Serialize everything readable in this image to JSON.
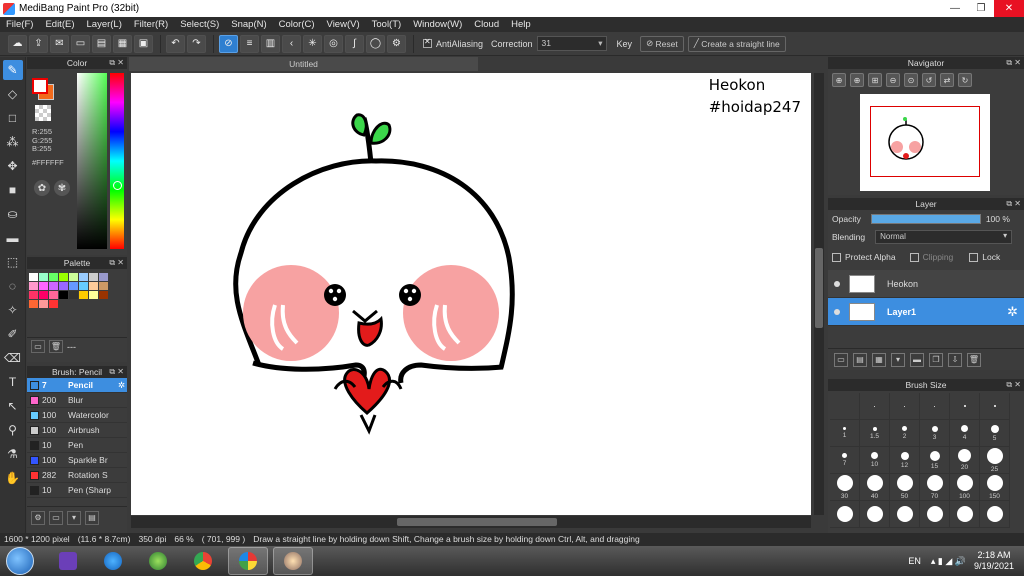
{
  "window": {
    "title": "MediBang Paint Pro (32bit)",
    "controls": [
      "—",
      "❐",
      "✕"
    ]
  },
  "menu": [
    "File(F)",
    "Edit(E)",
    "Layer(L)",
    "Filter(R)",
    "Select(S)",
    "Snap(N)",
    "Color(C)",
    "View(V)",
    "Tool(T)",
    "Window(W)",
    "Cloud",
    "Help"
  ],
  "toolbar": {
    "antialiasing_label": "AntiAliasing",
    "correction_label": "Correction",
    "correction_value": "31",
    "key_label": "Key",
    "reset_label": "Reset",
    "straight_line_label": "Create a straight line"
  },
  "color_panel": {
    "title": "Color",
    "r": "R:255",
    "g": "G:255",
    "b": "B:255",
    "hex": "#FFFFFF",
    "fg_color": "#FFFFFF",
    "bg_color": "#F26A1B"
  },
  "palette_panel": {
    "title": "Palette",
    "footer_text": "---",
    "colors": [
      "#ffffff",
      "#99ffcc",
      "#66ff66",
      "#99ff00",
      "#ccff99",
      "#99ccff",
      "#cccccc",
      "#9999cc",
      "#ff99cc",
      "#ff66ff",
      "#cc66ff",
      "#9966ff",
      "#6699ff",
      "#66ccff",
      "#ffcc99",
      "#cc9966",
      "#ff3366",
      "#ff0066",
      "#ff6699",
      "#000000",
      "#333333",
      "#ffcc00",
      "#ffff99",
      "#993300",
      "#ff6633",
      "#ff9999",
      "#ff3333",
      "#",
      "#",
      "#",
      "#",
      "#"
    ]
  },
  "brush_panel": {
    "title": "Brush: Pencil",
    "items": [
      {
        "size": "7",
        "name": "Pencil",
        "color": "#3d8ee0",
        "active": true
      },
      {
        "size": "200",
        "name": "Blur",
        "color": "#ff66cc",
        "active": false
      },
      {
        "size": "100",
        "name": "Watercolor",
        "color": "#66ccff",
        "active": false
      },
      {
        "size": "100",
        "name": "Airbrush",
        "color": "#cccccc",
        "active": false
      },
      {
        "size": "10",
        "name": "Pen",
        "color": "#222222",
        "active": false
      },
      {
        "size": "100",
        "name": "Sparkle Br",
        "color": "#3355ff",
        "active": false
      },
      {
        "size": "282",
        "name": "Rotation S",
        "color": "#ff3333",
        "active": false
      },
      {
        "size": "10",
        "name": "Pen (Sharp",
        "color": "#222222",
        "active": false
      }
    ]
  },
  "canvas": {
    "tab_title": "Untitled",
    "overlay_line1": "Heokon",
    "overlay_line2": "#hoidap247"
  },
  "navigator": {
    "title": "Navigator"
  },
  "layer_panel": {
    "title": "Layer",
    "opacity_label": "Opacity",
    "opacity_value": "100 %",
    "opacity_fraction": 1.0,
    "blending_label": "Blending",
    "blending_value": "Normal",
    "protect_alpha_label": "Protect Alpha",
    "clipping_label": "Clipping",
    "lock_label": "Lock",
    "layers": [
      {
        "name": "Heokon",
        "active": false
      },
      {
        "name": "Layer1",
        "active": true
      }
    ]
  },
  "brush_size_panel": {
    "title": "Brush Size",
    "sizes": [
      "",
      ".",
      ".",
      ".",
      ".",
      ".",
      "1",
      "1.5",
      "2",
      "3",
      "4",
      "5",
      "7",
      "10",
      "12",
      "15",
      "20",
      "25",
      "30",
      "40",
      "50",
      "70",
      "100",
      "150",
      "",
      "",
      "",
      "",
      "",
      ""
    ]
  },
  "status": {
    "pixels": "1600 * 1200 pixel",
    "physical": "(11.6 * 8.7cm)",
    "dpi": "350 dpi",
    "zoom": "66 %",
    "coords": "( 701, 999 )",
    "hint": "Draw a straight line by holding down Shift, Change a brush size by holding down Ctrl, Alt, and dragging"
  },
  "taskbar": {
    "language": "EN",
    "time": "2:18 AM",
    "date": "9/19/2021"
  }
}
